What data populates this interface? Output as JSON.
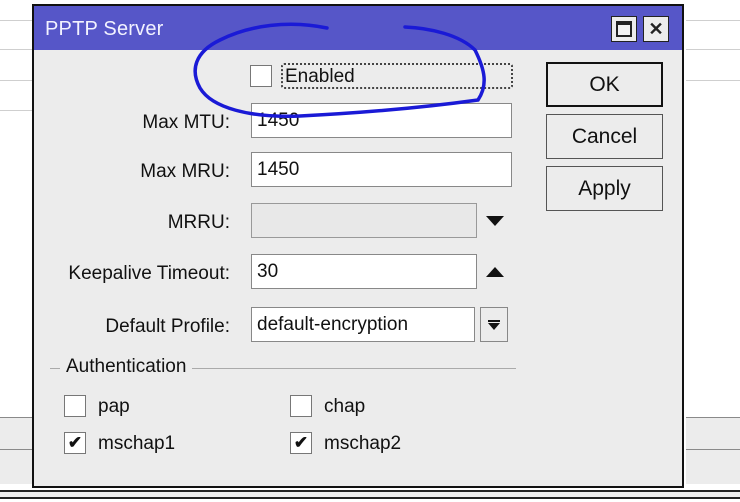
{
  "window": {
    "title": "PPTP Server",
    "maximize_icon": "maximize-icon",
    "close_icon": "close-icon"
  },
  "enabled": {
    "label": "Enabled",
    "checked": false
  },
  "fields": {
    "max_mtu": {
      "label": "Max MTU:",
      "value": "1450"
    },
    "max_mru": {
      "label": "Max MRU:",
      "value": "1450"
    },
    "mrru": {
      "label": "MRRU:",
      "value": "",
      "toggle_icon": "arrow-down-icon"
    },
    "keepalive_timeout": {
      "label": "Keepalive Timeout:",
      "value": "30",
      "toggle_icon": "arrow-up-icon"
    },
    "default_profile": {
      "label": "Default Profile:",
      "value": "default-encryption",
      "dropdown_icon": "dropdown-icon"
    }
  },
  "buttons": {
    "ok": "OK",
    "cancel": "Cancel",
    "apply": "Apply"
  },
  "authentication": {
    "title": "Authentication",
    "options": [
      {
        "label": "pap",
        "checked": false
      },
      {
        "label": "chap",
        "checked": false
      },
      {
        "label": "mschap1",
        "checked": true
      },
      {
        "label": "mschap2",
        "checked": true
      }
    ]
  },
  "check_glyph": "✔",
  "colors": {
    "titlebar": "#5656c8",
    "annotation": "#1a1ad6"
  }
}
